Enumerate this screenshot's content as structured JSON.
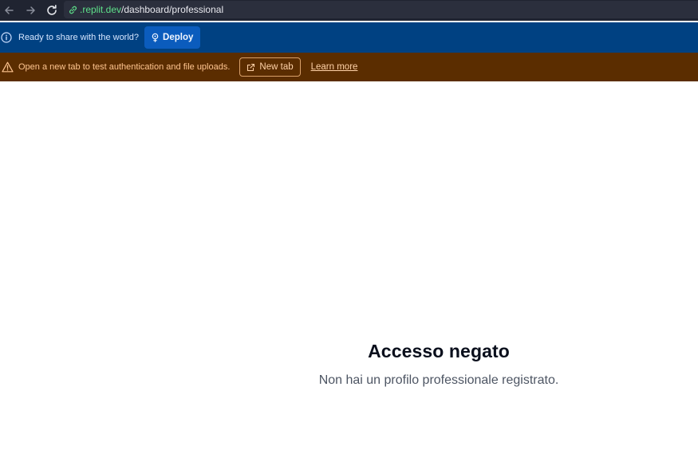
{
  "browser": {
    "url_host": ".replit.dev",
    "url_path": "/dashboard/professional"
  },
  "deploy_banner": {
    "message": "Ready to share with the world?",
    "button_label": "Deploy"
  },
  "auth_banner": {
    "message": "Open a new tab to test authentication and file uploads.",
    "new_tab_label": "New tab",
    "learn_more_label": "Learn more"
  },
  "main": {
    "title": "Accesso negato",
    "message": "Non hai un profilo professionale registrato."
  },
  "colors": {
    "address_bar": "#202431",
    "deploy_banner": "#004182",
    "warning_banner": "#5b2d00",
    "url_host": "#5ee08a"
  }
}
